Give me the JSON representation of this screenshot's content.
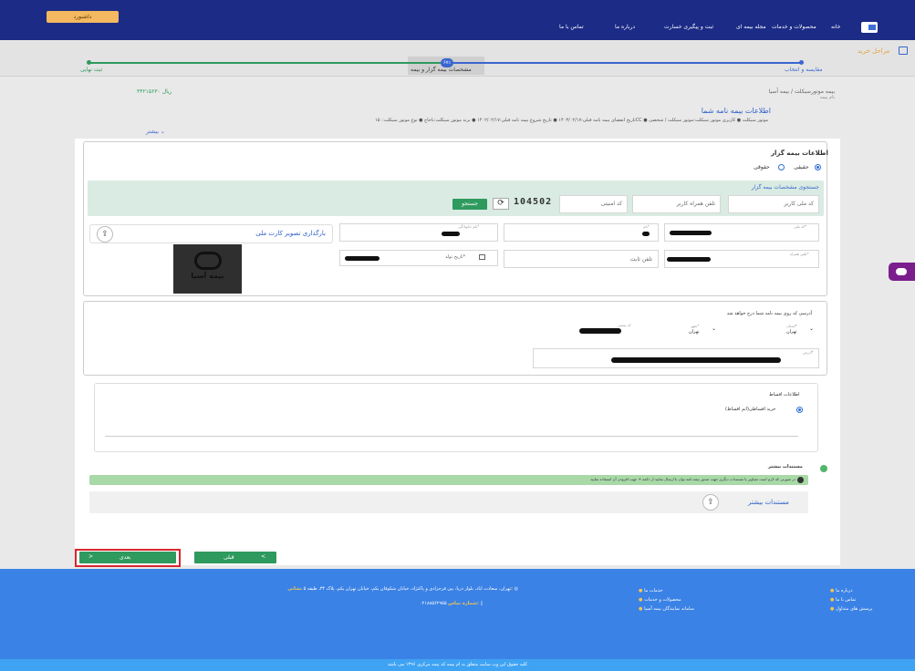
{
  "header": {
    "dashboard_label": "داشبورد",
    "nav": [
      "خانه",
      "محصولات و خدمات",
      "مجله بیمه ای",
      "ثبت و پیگیری خسارت",
      "درباره ما",
      "تماس با ما"
    ]
  },
  "steps": {
    "title": "مراحل خرید",
    "step1": "مقایسه و انتخاب",
    "step2": "مشخصات بیمه گزار و بیمه",
    "step2_badge": "۶۷٪",
    "step3": "ثبت نهایی"
  },
  "summary": {
    "breadcrumb": "بیمه موتورسیکلت / بیمه آسیا",
    "subtitle": "نام بیمه",
    "price": "۳۴۲۱۵۶۳۰ ریال",
    "title": "اطلاعات بیمه نامه شما",
    "details": "تاریخ انقضای بیمه نامه قبلی:۱۴۰۳/۰۲/۱۷ ● تاریخ شروع بیمه نامه قبلی:۱۴۰۲/۰۲/۱۷ ● برند موتور سیکلت:باجاج ● نوع موتور سیکلت:۱۵۰CC ● موتور سیکلت ● کاربری موتور سیکلت:موتور سیکلت / شخصی",
    "more": "بیشتر"
  },
  "insurer": {
    "title": "اطلاعات بیمه گزار",
    "type_real": "حقیقی",
    "type_legal": "حقوقی",
    "search_title": "جستجوی مشخصات بیمه گزار",
    "national_code_placeholder": "کد ملی کاربر",
    "mobile_placeholder": "تلفن همراه کاربر",
    "captcha_placeholder": "کد امنیتی",
    "captcha_text": "104502",
    "search_button": "جستجو",
    "lbl_national": "کد ملی*",
    "lbl_name": "نام*",
    "lbl_family": "نام خانوادگی*",
    "lbl_mobile": "تلفن همراه*",
    "lbl_phone": "تلفن ثابت",
    "birth_placeholder": "تاریخ تولد*",
    "upload_label": "بارگذاری تصویر کارت ملی",
    "logo_text": "بیمه آسیا"
  },
  "address": {
    "title": "آدرسی که روی بیمه نامه شما درج خواهد شد",
    "lbl_province": "استان*",
    "province": "تهران",
    "lbl_city": "شهر*",
    "city": "تهران",
    "lbl_postal": "کد پستی",
    "lbl_address": "آدرس*"
  },
  "installments": {
    "title": "اطلاعات اقساط",
    "option": "خرید اقساطی(اتم اقساط)"
  },
  "docs": {
    "title": "مستندات بیشتر",
    "notice": "در صورتی که لازم است تصاویر یا مستندات دیگری جهت صدور بیمه نامه توان با ارسال نمایید از دکمه + جهت افزودن آن استفاده نمایید",
    "upload_label": "مستندات بیشتر"
  },
  "buttons": {
    "next": "بعدی",
    "prev": "قبلی"
  },
  "footer": {
    "links_col1": [
      "درباره ما",
      "تماس با ما",
      "پرسش های متداول"
    ],
    "links_col2": [
      "خدمات ما",
      "محصولات و خدمات",
      "سامانه نمایندگان بیمه آسیا"
    ],
    "address_label": "نشانی:",
    "address": "تهران، سعادت آباد، بلوار دریا، بین فرحزادی و پاکنژاد، خیابان شکوفان یکم، خیابان تهران یکم، پلاک ۳۴، طبقه ۵",
    "phone_label": "شماره تماس:",
    "phone": "۰۲۱۸۸۵۶۲۹۵۵",
    "copyright": "کلیه حقوق این وب سایت متعلق به ام بیمه کد بیمه مرکزی ۱۳۹۶ می باشد"
  }
}
